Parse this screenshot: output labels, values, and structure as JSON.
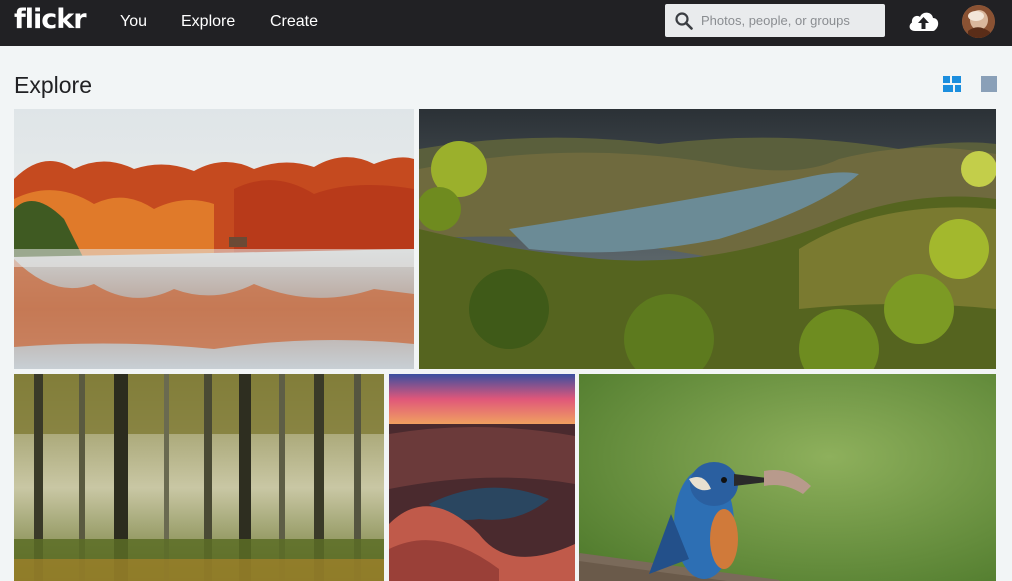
{
  "header": {
    "logo": "flickr",
    "nav": [
      {
        "label": "You"
      },
      {
        "label": "Explore"
      },
      {
        "label": "Create"
      }
    ],
    "search": {
      "placeholder": "Photos, people, or groups",
      "value": ""
    },
    "icons": {
      "search": "search-icon",
      "upload": "cloud-upload-icon",
      "avatar": "user-avatar"
    }
  },
  "page": {
    "title": "Explore",
    "view_modes": [
      "justified-view-icon",
      "single-view-icon"
    ],
    "active_view": "justified"
  },
  "photos": [
    {
      "subject": "autumn-lake-reflection"
    },
    {
      "subject": "river-valley-vineyards"
    },
    {
      "subject": "misty-autumn-forest"
    },
    {
      "subject": "canyon-sunset"
    },
    {
      "subject": "kingfisher-with-fish"
    }
  ],
  "colors": {
    "topbar": "#212124",
    "page_bg": "#f2f5f6",
    "accent_blue": "#1c8ede",
    "inactive_icon": "#8aa0b8"
  }
}
